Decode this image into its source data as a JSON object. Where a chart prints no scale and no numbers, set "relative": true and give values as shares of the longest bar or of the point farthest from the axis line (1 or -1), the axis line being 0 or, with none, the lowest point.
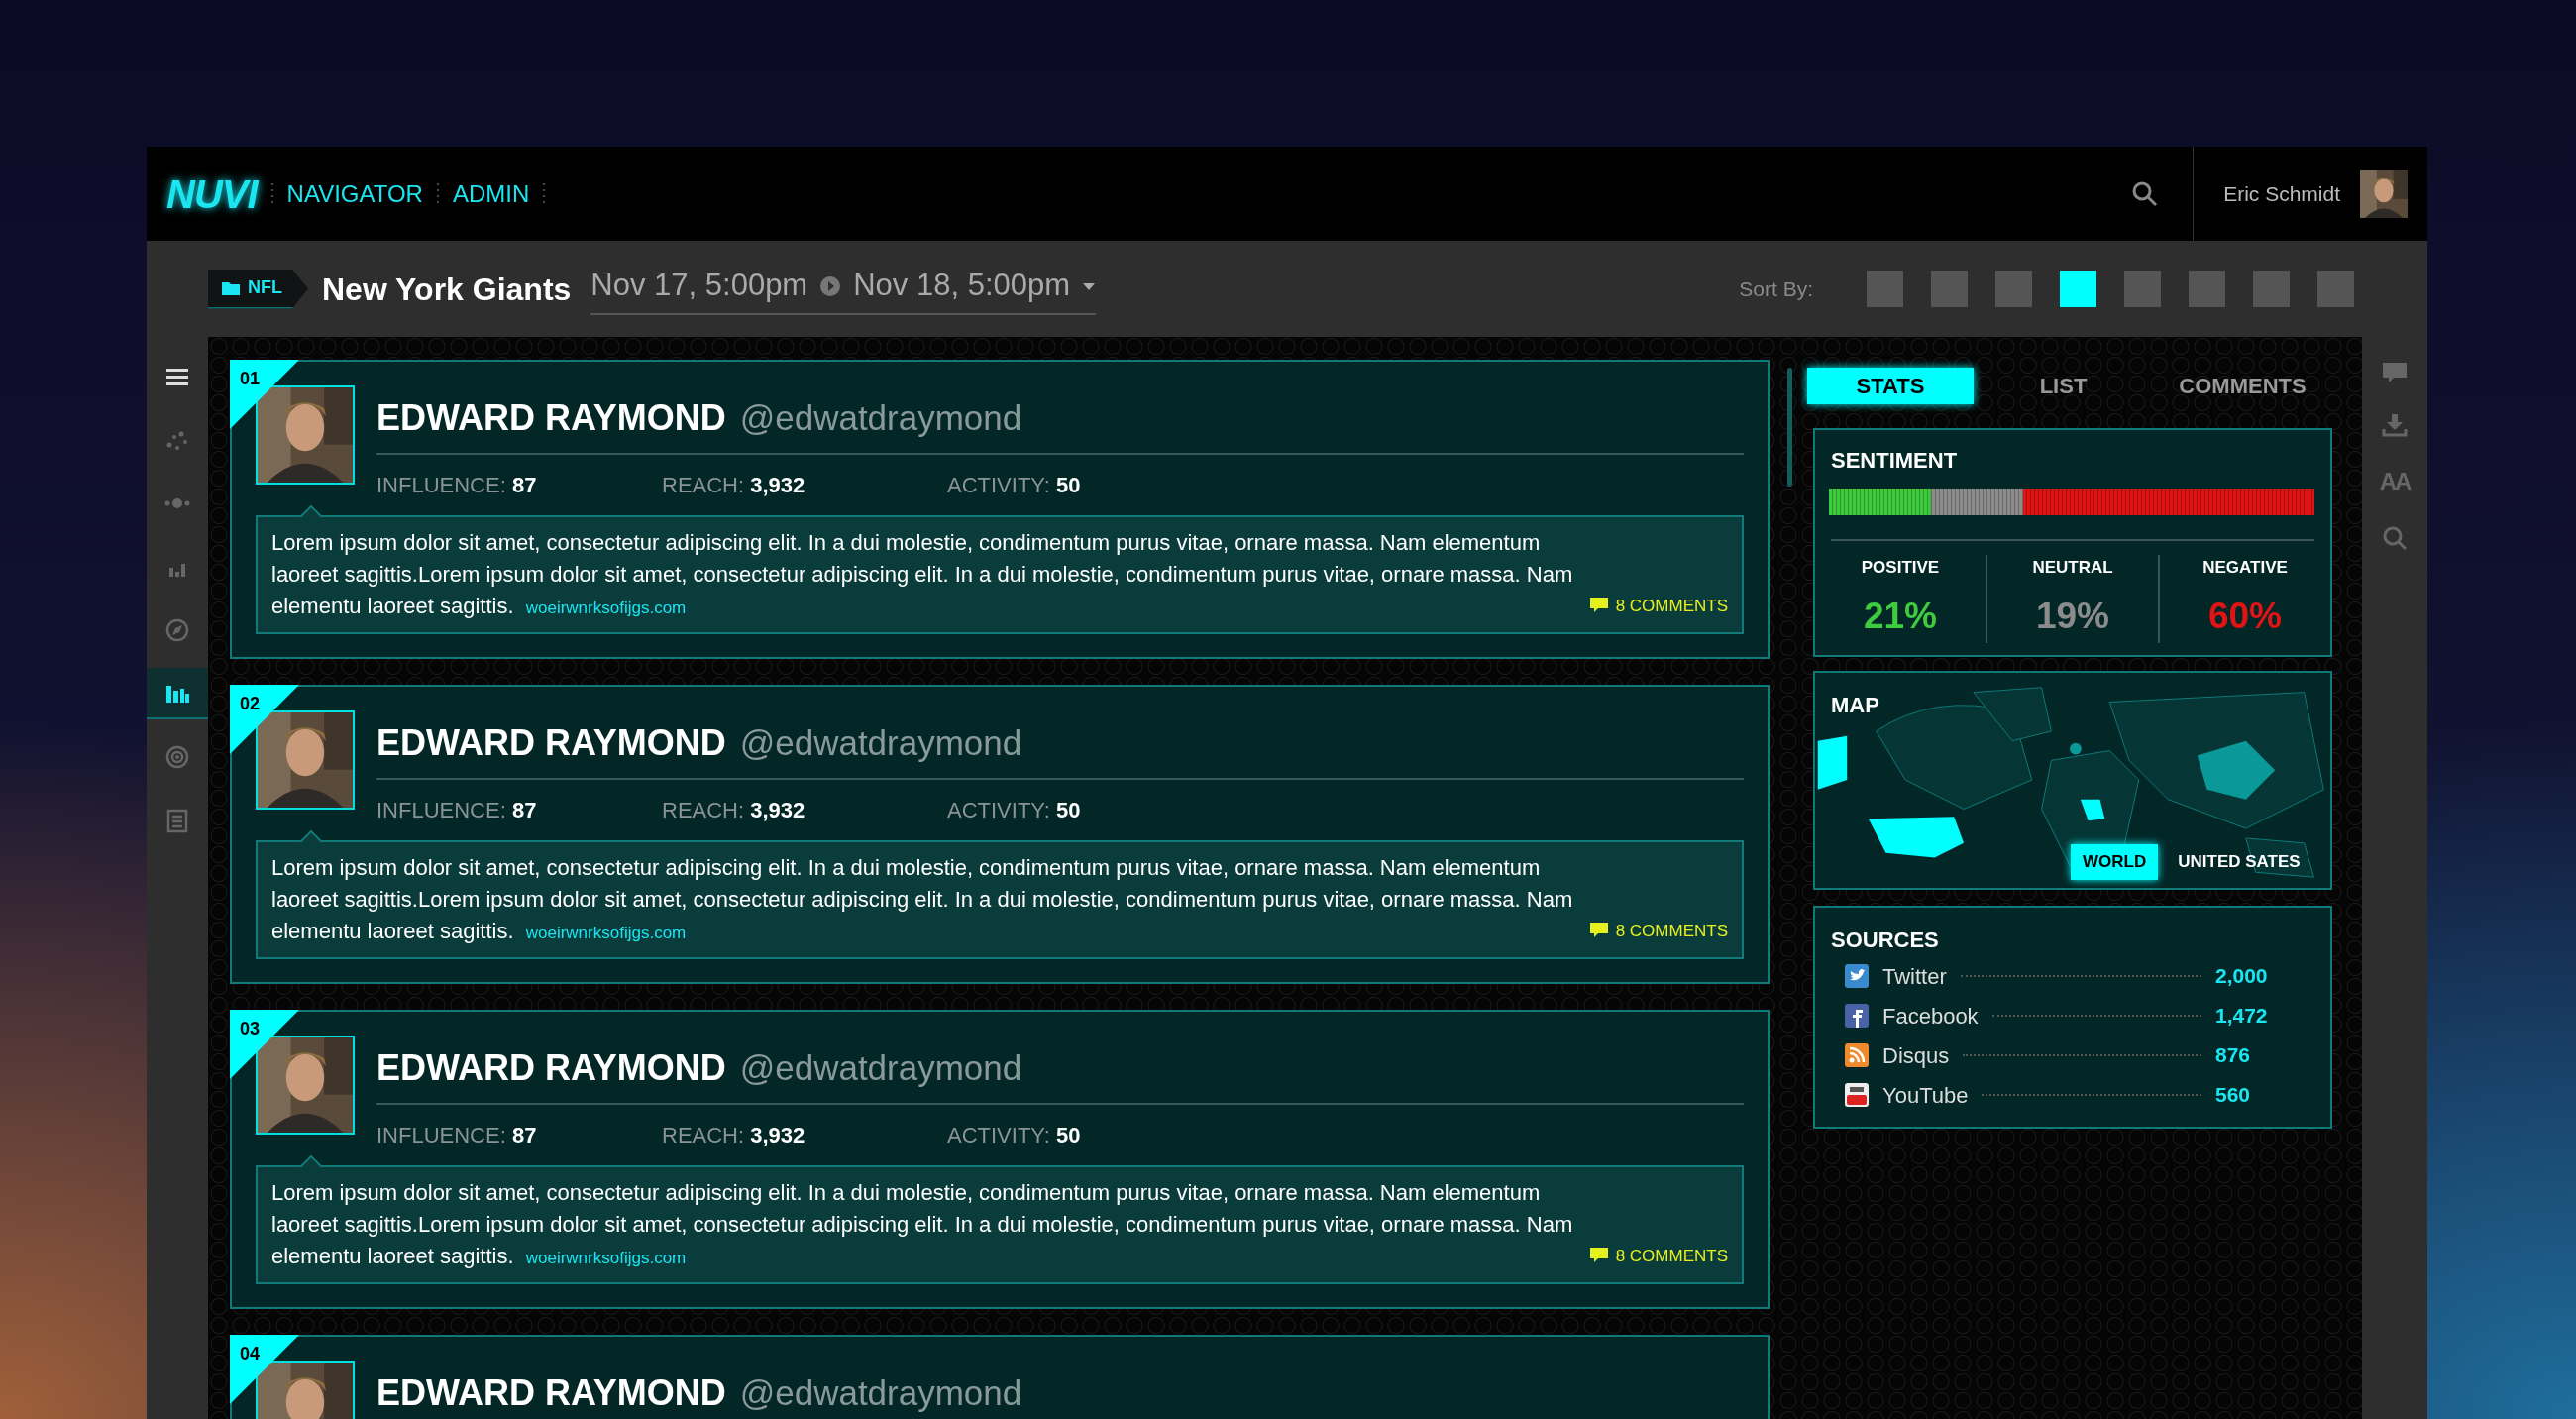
{
  "header": {
    "logo": "NUVI",
    "nav": [
      {
        "label": "NAVIGATOR"
      },
      {
        "label": "ADMIN"
      }
    ],
    "user": {
      "name": "Eric Schmidt"
    }
  },
  "subheader": {
    "category": "NFL",
    "title": "New York Giants",
    "date_from": "Nov 17, 5:00pm",
    "date_to": "Nov 18, 5:00pm",
    "sort_label": "Sort By:",
    "sort_options": [
      {
        "selected": false
      },
      {
        "selected": false
      },
      {
        "selected": false
      },
      {
        "selected": true
      },
      {
        "selected": false
      },
      {
        "selected": false
      },
      {
        "selected": false
      },
      {
        "selected": false
      }
    ]
  },
  "left_rail": [
    {
      "kind": "menu",
      "selected": false
    },
    {
      "kind": "scatter",
      "selected": false
    },
    {
      "kind": "nodes",
      "selected": false
    },
    {
      "kind": "bars",
      "selected": false
    },
    {
      "kind": "compass",
      "selected": false
    },
    {
      "kind": "columns",
      "selected": true
    },
    {
      "kind": "radar",
      "selected": false
    },
    {
      "kind": "document",
      "selected": false
    }
  ],
  "posts": [
    {
      "rank": "01",
      "name": "EDWARD RAYMOND",
      "handle": "@edwatdraymond",
      "stats": [
        {
          "label": "INFLUENCE:",
          "value": "87"
        },
        {
          "label": "REACH:",
          "value": "3,932"
        },
        {
          "label": "ACTIVITY:",
          "value": "50"
        }
      ],
      "text": "Lorem ipsum dolor sit amet, consectetur adipiscing elit. In a dui molestie, condimentum purus vitae, ornare massa. Nam elementum laoreet sagittis.Lorem ipsum dolor sit amet, consectetur adipiscing elit. In a dui molestie, condimentum purus vitae, ornare massa. Nam elementu laoreet sagittis.",
      "link": "woeirwnrksofijgs.com",
      "comments": "8 COMMENTS"
    },
    {
      "rank": "02",
      "name": "EDWARD RAYMOND",
      "handle": "@edwatdraymond",
      "stats": [
        {
          "label": "INFLUENCE:",
          "value": "87"
        },
        {
          "label": "REACH:",
          "value": "3,932"
        },
        {
          "label": "ACTIVITY:",
          "value": "50"
        }
      ],
      "text": "Lorem ipsum dolor sit amet, consectetur adipiscing elit. In a dui molestie, condimentum purus vitae, ornare massa. Nam elementum laoreet sagittis.Lorem ipsum dolor sit amet, consectetur adipiscing elit. In a dui molestie, condimentum purus vitae, ornare massa. Nam elementu laoreet sagittis.",
      "link": "woeirwnrksofijgs.com",
      "comments": "8 COMMENTS"
    },
    {
      "rank": "03",
      "name": "EDWARD RAYMOND",
      "handle": "@edwatdraymond",
      "stats": [
        {
          "label": "INFLUENCE:",
          "value": "87"
        },
        {
          "label": "REACH:",
          "value": "3,932"
        },
        {
          "label": "ACTIVITY:",
          "value": "50"
        }
      ],
      "text": "Lorem ipsum dolor sit amet, consectetur adipiscing elit. In a dui molestie, condimentum purus vitae, ornare massa. Nam elementum laoreet sagittis.Lorem ipsum dolor sit amet, consectetur adipiscing elit. In a dui molestie, condimentum purus vitae, ornare massa. Nam elementu laoreet sagittis.",
      "link": "woeirwnrksofijgs.com",
      "comments": "8 COMMENTS"
    },
    {
      "rank": "04",
      "name": "EDWARD RAYMOND",
      "handle": "@edwatdraymond"
    }
  ],
  "panel": {
    "tabs": [
      {
        "label": "STATS",
        "selected": true
      },
      {
        "label": "LIST",
        "selected": false
      },
      {
        "label": "COMMENTS",
        "selected": false
      }
    ],
    "sentiment": {
      "title": "SENTIMENT",
      "chart_data": {
        "type": "bar",
        "orientation": "horizontal",
        "stacked": true,
        "relative": true,
        "series": [
          {
            "color": "#3ecc3e",
            "values": [
              0.21
            ]
          },
          {
            "color": "#8c8c8c",
            "values": [
              0.19
            ]
          },
          {
            "color": "#e01414",
            "values": [
              0.6
            ]
          }
        ]
      },
      "items": [
        {
          "label": "POSITIVE",
          "value": "21%",
          "color": "#3ecc3e"
        },
        {
          "label": "NEUTRAL",
          "value": "19%",
          "color": "#8c8c8c"
        },
        {
          "label": "NEGATIVE",
          "value": "60%",
          "color": "#e01414"
        }
      ]
    },
    "map": {
      "title": "MAP",
      "toggles": [
        {
          "label": "WORLD",
          "selected": true
        },
        {
          "label": "UNITED SATES",
          "selected": false
        }
      ]
    },
    "sources": {
      "title": "SOURCES",
      "items": [
        {
          "kind": "twitter",
          "name": "Twitter",
          "value": "2,000"
        },
        {
          "kind": "facebook",
          "name": "Facebook",
          "value": "1,472"
        },
        {
          "kind": "rss",
          "name": "Disqus",
          "value": "876"
        },
        {
          "kind": "youtube",
          "name": "YouTube",
          "value": "560"
        }
      ]
    }
  },
  "right_rail": [
    {
      "kind": "comment"
    },
    {
      "kind": "download"
    },
    {
      "kind": "text-size",
      "label": "AA"
    },
    {
      "kind": "search"
    }
  ]
}
